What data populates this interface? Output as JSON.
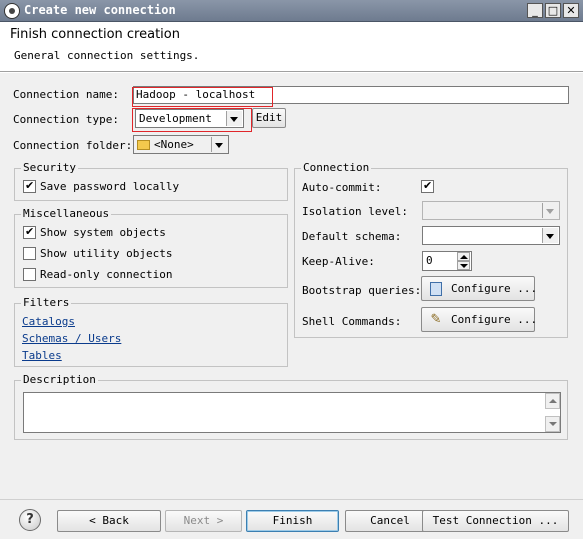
{
  "window": {
    "title": "Create new connection",
    "controls": {
      "minimize": "_",
      "maximize": "□",
      "close": "✕"
    }
  },
  "header": {
    "title": "Finish connection creation",
    "subtitle": "General connection settings."
  },
  "form": {
    "connection_name_label": "Connection name:",
    "connection_name_value": "Hadoop - localhost",
    "connection_type_label": "Connection type:",
    "connection_type_value": "Development",
    "edit_button": "Edit",
    "connection_folder_label": "Connection folder:",
    "connection_folder_value": "<None>"
  },
  "security": {
    "legend": "Security",
    "save_password_label": "Save password locally",
    "save_password_checked": true
  },
  "miscellaneous": {
    "legend": "Miscellaneous",
    "items": [
      {
        "label": "Show system objects",
        "checked": true
      },
      {
        "label": "Show utility objects",
        "checked": false
      },
      {
        "label": "Read-only connection",
        "checked": false
      }
    ]
  },
  "filters": {
    "legend": "Filters",
    "links": [
      "Catalogs",
      "Schemas / Users",
      "Tables"
    ]
  },
  "connection": {
    "legend": "Connection",
    "auto_commit_label": "Auto-commit:",
    "auto_commit_checked": true,
    "isolation_level_label": "Isolation level:",
    "isolation_level_value": "",
    "default_schema_label": "Default schema:",
    "default_schema_value": "",
    "keep_alive_label": "Keep-Alive:",
    "keep_alive_value": "0",
    "bootstrap_queries_label": "Bootstrap queries:",
    "bootstrap_configure": "Configure ...",
    "shell_commands_label": "Shell Commands:",
    "shell_configure": "Configure ..."
  },
  "description": {
    "legend": "Description",
    "value": ""
  },
  "footer": {
    "help": "?",
    "back": "< Back",
    "next": "Next >",
    "finish": "Finish",
    "cancel": "Cancel",
    "test_connection": "Test Connection ..."
  },
  "colors": {
    "highlight": "#e0262a",
    "link": "#0a3b8c"
  }
}
